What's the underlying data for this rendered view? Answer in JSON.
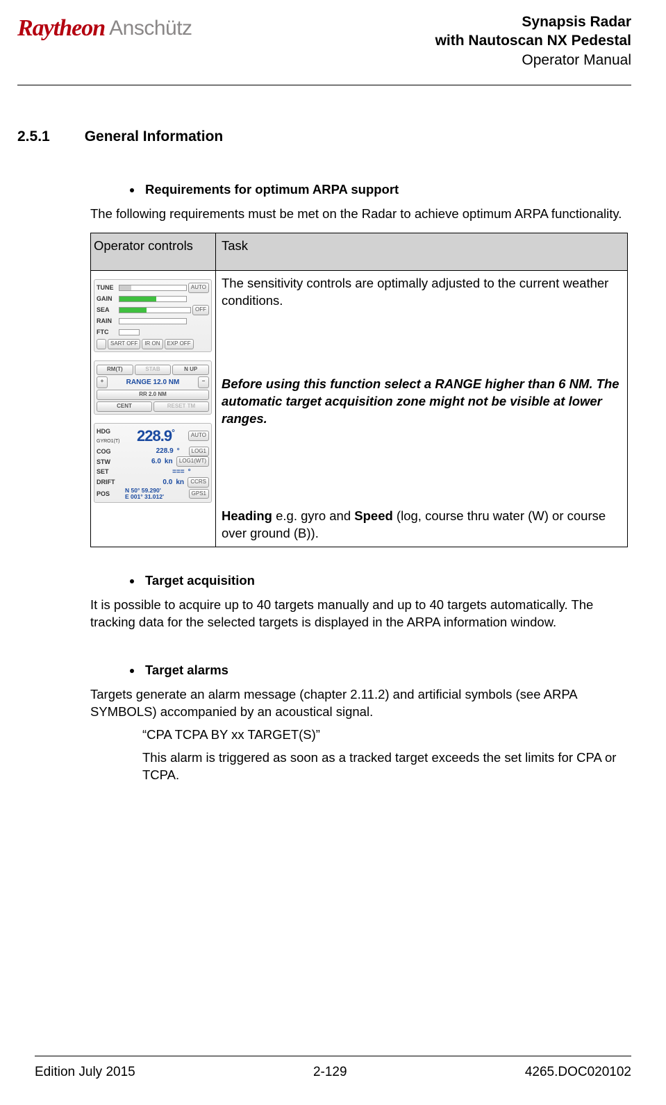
{
  "header": {
    "logo1": "Raytheon",
    "logo2": "Anschütz",
    "title1": "Synapsis Radar",
    "title2": "with Nautoscan NX Pedestal",
    "title3": "Operator Manual"
  },
  "section": {
    "num": "2.5.1",
    "title": "General Information"
  },
  "b1": {
    "head": "Requirements for optimum ARPA support",
    "intro": "The following requirements must be met on the Radar to achieve optimum ARPA functionality.",
    "th1": "Operator controls",
    "th2": "Task",
    "task1": "The sensitivity controls are optimally adjusted to the current weather conditions.",
    "task2": "Before using this function select a RANGE higher than 6 NM. The automatic target acquisition zone might not be visible at lower ranges.",
    "task3a": "Heading",
    "task3b": " e.g. gyro and ",
    "task3c": "Speed",
    "task3d": " (log, course thru water (W) or course over ground (B))."
  },
  "panel1": {
    "r1": "TUNE",
    "r1b": "AUTO",
    "r2": "GAIN",
    "r3": "SEA",
    "r3b": "OFF",
    "r4": "RAIN",
    "r5": "FTC",
    "btns": [
      "",
      "SART OFF",
      "IR ON",
      "EXP OFF"
    ]
  },
  "panel2": {
    "rm": "RM(T)",
    "stab": "STAB",
    "nup": "N UP",
    "plus": "+",
    "minus": "−",
    "range": "RANGE 12.0 NM",
    "rr": "RR 2.0 NM",
    "cent": "CENT",
    "reset": "RESET TM"
  },
  "panel3": {
    "hdg_lbl": "HDG",
    "hdg_src": "GYRO1(T)",
    "hdg_val": "228.9",
    "hdg_deg": "°",
    "auto": "AUTO",
    "cog": "COG",
    "cog_v": "228.9",
    "cog_u": "°",
    "cog_b": "LOG1",
    "stw": "STW",
    "stw_v": "6.0",
    "stw_u": "kn",
    "stw_b": "LOG1(WT)",
    "set": "SET",
    "set_v": "===",
    "set_u": "°",
    "drift": "DRIFT",
    "drift_v": "0.0",
    "drift_u": "kn",
    "drift_b": "CCRS",
    "pos": "POS",
    "pos_v1": "N 50° 59.290'",
    "pos_v2": "E 001° 31.012'",
    "pos_b": "GPS1"
  },
  "b2": {
    "head": "Target acquisition",
    "text": "It is possible to acquire up to 40 targets manually and up to 40 targets automatically. The tracking data for the selected targets is displayed in the ARPA information window."
  },
  "b3": {
    "head": "Target alarms",
    "p1": "Targets generate an alarm message (chapter 2.11.2) and artificial symbols (see ARPA SYMBOLS) accompanied by an acoustical signal.",
    "q1": "“CPA TCPA BY xx TARGET(S)”",
    "q2": "This alarm is triggered as soon as a tracked target exceeds the set limits for CPA or TCPA."
  },
  "footer": {
    "left": "Edition July 2015",
    "center": "2-129",
    "right": "4265.DOC020102"
  }
}
